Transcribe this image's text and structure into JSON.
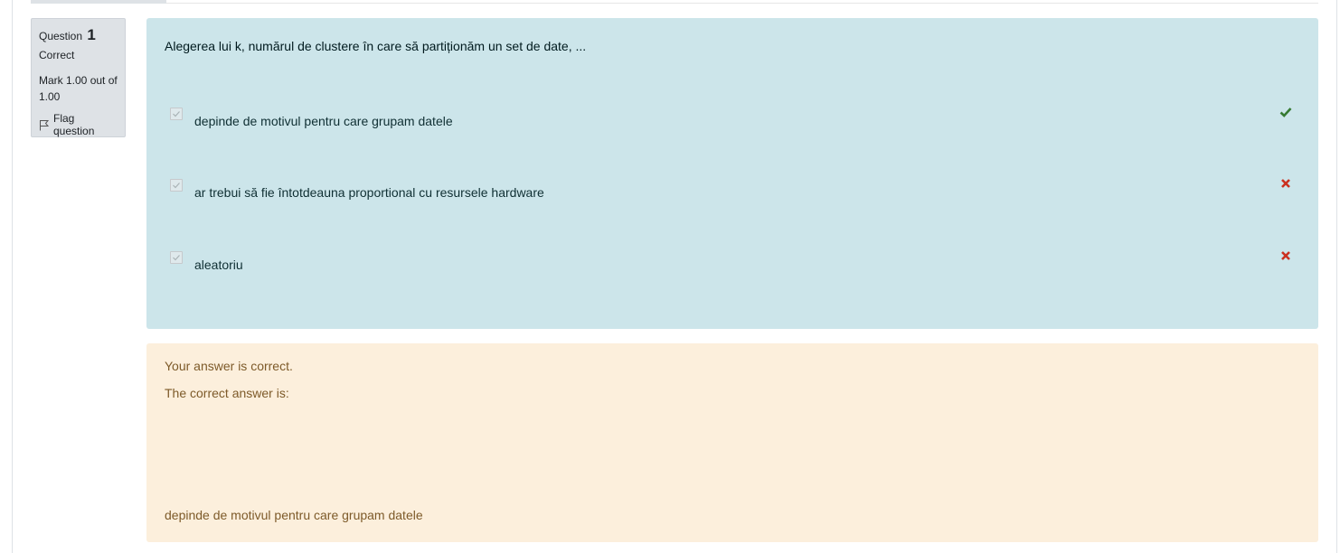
{
  "info": {
    "question_label": "Question",
    "question_number": "1",
    "state": "Correct",
    "grade": "Mark 1.00 out of 1.00",
    "flag_label": "Flag question"
  },
  "question": {
    "text": "Alegerea lui k, numărul de clustere în care să partiționăm un set de date, ...",
    "answers": [
      {
        "label": "depinde de motivul pentru care grupam datele",
        "checked": true,
        "mark_icon": "check-icon",
        "mark_color": "#357a32"
      },
      {
        "label": "ar trebui să fie întotdeauna proportional cu resursele hardware",
        "checked": true,
        "mark_icon": "cross-icon",
        "mark_color": "#ca3120"
      },
      {
        "label": "aleatoriu",
        "checked": true,
        "mark_icon": "cross-icon",
        "mark_color": "#ca3120"
      }
    ]
  },
  "feedback": {
    "line1": "Your answer is correct.",
    "line2": "The correct answer is:",
    "correct_answer": "depinde de motivul pentru care grupam datele"
  },
  "colors": {
    "formulation_bg": "#cce5ea",
    "feedback_bg": "#fcefdc",
    "info_bg": "#dee2e6"
  }
}
